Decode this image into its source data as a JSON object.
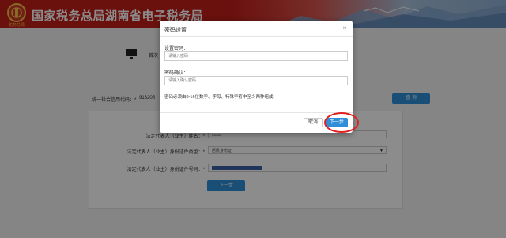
{
  "header": {
    "site_title": "国家税务总局湖南省电子税务局",
    "emblem_subtitle": "税务总局"
  },
  "steps": {
    "current_label": "首次"
  },
  "credit": {
    "label": "统一社会信用代码：*",
    "value": "913205",
    "query_label": "查 询"
  },
  "form": {
    "rows": [
      {
        "label": "法定代表人（业主）姓名：*",
        "value": "xxxxx"
      },
      {
        "label": "法定代表人（业主）身份证件类型：*",
        "value": "居民身份证"
      },
      {
        "label": "法定代表人（业主）身份证件号码：*",
        "value": ""
      }
    ],
    "next_label": "下一步"
  },
  "modal": {
    "title": "密码设置",
    "close_symbol": "×",
    "password_label": "设置密码：",
    "password_placeholder": "请输入密码",
    "confirm_label": "密码确认：",
    "confirm_placeholder": "请输入确认密码",
    "rule_text": "密码必须由8-16位数字、字母、特殊字符中至少两种组成",
    "cancel_label": "取消",
    "next_label": "下一步"
  },
  "colors": {
    "brand_red": "#c2201b",
    "primary_blue": "#2f8ed8",
    "highlight_red": "#e02020"
  }
}
